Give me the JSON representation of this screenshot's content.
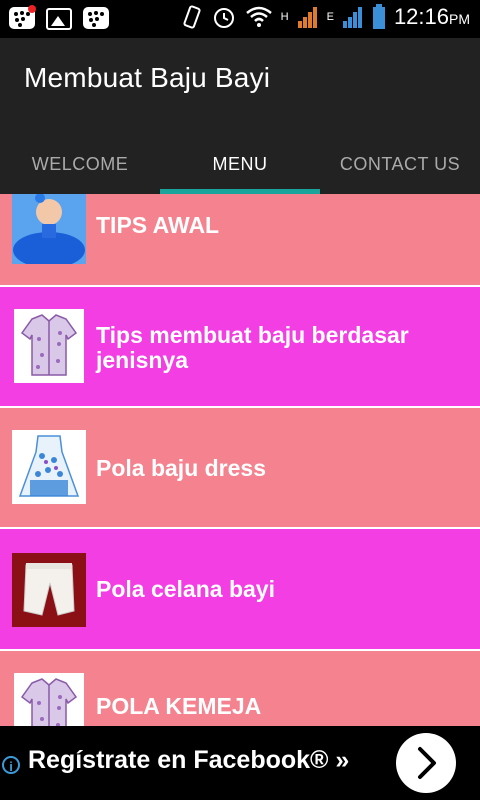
{
  "status_bar": {
    "time": "12:16",
    "ampm": "PM",
    "network_label": "H",
    "network_label_2": "E"
  },
  "app": {
    "title": "Membuat Baju Bayi"
  },
  "tabs": [
    {
      "label": "WELCOME",
      "active": false
    },
    {
      "label": "MENU",
      "active": true
    },
    {
      "label": "CONTACT US",
      "active": false
    }
  ],
  "menu_items": [
    {
      "label": "TIPS AWAL",
      "thumb": "baby-blue-dress",
      "bg": "#f4838f"
    },
    {
      "label": "Tips membuat baju berdasar jenisnya",
      "thumb": "purple-shirt",
      "bg": "#f23ee3"
    },
    {
      "label": "Pola baju dress",
      "thumb": "floral-dress",
      "bg": "#f4838f"
    },
    {
      "label": "Pola celana bayi",
      "thumb": "white-pants",
      "bg": "#f23ee3"
    },
    {
      "label": "POLA KEMEJA",
      "thumb": "purple-shirt",
      "bg": "#f4838f"
    }
  ],
  "ad": {
    "text": "Regístrate en Facebook® »",
    "info_glyph": "i"
  },
  "colors": {
    "pink": "#f4838f",
    "magenta": "#f23ee3",
    "tab_indicator": "#19a59b",
    "appbar": "#222222"
  }
}
